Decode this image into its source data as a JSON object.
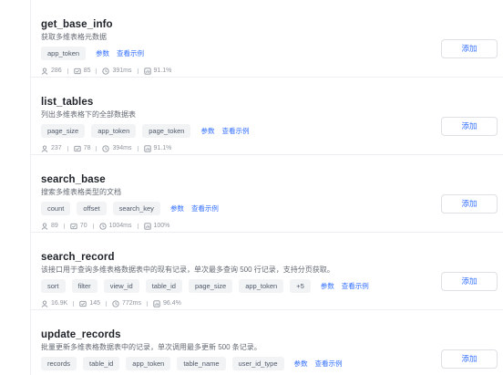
{
  "plugins": [
    {
      "name": "get_base_info",
      "description": "获取多维表格元数据",
      "params": [
        "app_token"
      ],
      "params_label": "参数",
      "example_label": "查看示例",
      "stats": {
        "users": "286",
        "calls": "85",
        "latency": "391ms",
        "success": "91.1%"
      },
      "add_label": "添加"
    },
    {
      "name": "list_tables",
      "description": "列出多维表格下的全部数据表",
      "params": [
        "page_size",
        "app_token",
        "page_token"
      ],
      "params_label": "参数",
      "example_label": "查看示例",
      "stats": {
        "users": "237",
        "calls": "78",
        "latency": "394ms",
        "success": "91.1%"
      },
      "add_label": "添加"
    },
    {
      "name": "search_base",
      "description": "搜索多维表格类型的文档",
      "params": [
        "count",
        "offset",
        "search_key"
      ],
      "params_label": "参数",
      "example_label": "查看示例",
      "stats": {
        "users": "89",
        "calls": "70",
        "latency": "1004ms",
        "success": "100%"
      },
      "add_label": "添加"
    },
    {
      "name": "search_record",
      "description": "该接口用于查询多维表格数据表中的现有记录，单次最多查询 500 行记录，支持分页获取。",
      "params": [
        "sort",
        "filter",
        "view_id",
        "table_id",
        "page_size",
        "app_token",
        "+5"
      ],
      "params_label": "参数",
      "example_label": "查看示例",
      "stats": {
        "users": "16.9K",
        "calls": "145",
        "latency": "772ms",
        "success": "96.4%"
      },
      "add_label": "添加"
    },
    {
      "name": "update_records",
      "description": "批量更新多维表格数据表中的记录，单次调用最多更新 500 条记录。",
      "params": [
        "records",
        "table_id",
        "app_token",
        "table_name",
        "user_id_type"
      ],
      "params_label": "参数",
      "example_label": "查看示例",
      "stats": {
        "users": "",
        "calls": "",
        "latency": "",
        "success": ""
      },
      "add_label": "添加"
    }
  ],
  "colors": {
    "accent": "#3370ff",
    "chip_bg": "#f2f3f5",
    "muted": "#8f959e"
  },
  "icons": {
    "users": "users-icon",
    "calls": "calls-icon",
    "latency": "clock-icon",
    "success": "success-rate-icon"
  }
}
